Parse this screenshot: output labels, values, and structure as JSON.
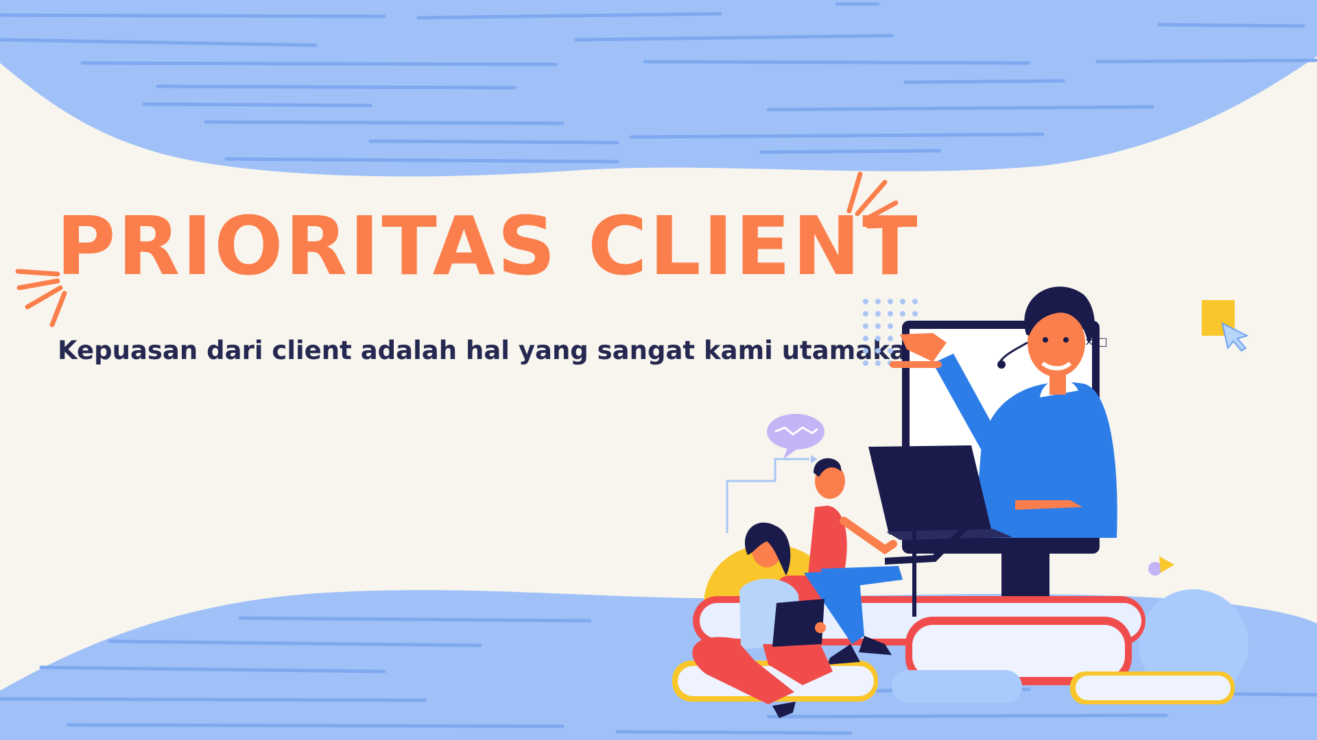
{
  "banner": {
    "title": "PRIORITAS CLIENT",
    "subtitle": "Kepuasan dari client adalah hal yang sangat kami utamakan"
  },
  "colors": {
    "background": "#f8f5ee",
    "wave_blue": "#a0c1f8",
    "wave_stroke": "#7ea9ef",
    "title_orange": "#fb7f4c",
    "subtitle_navy": "#252850",
    "accent_yellow": "#f9c62b",
    "accent_red": "#f04c4c",
    "accent_blue": "#2d7de8",
    "accent_purple": "#c4b3f5"
  },
  "illustration": {
    "window_controls": [
      "_",
      "×",
      "□"
    ],
    "icons": [
      "burst-lines-icon",
      "monitor-icon",
      "laptop-icon",
      "tablet-icon",
      "speech-bubble-icon",
      "cursor-arrow-icon",
      "books-icon",
      "dot-grid-icon",
      "play-icon"
    ]
  }
}
